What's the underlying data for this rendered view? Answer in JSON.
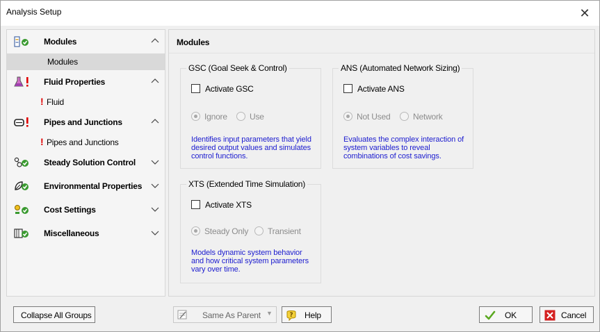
{
  "window": {
    "title": "Analysis Setup",
    "close_glyph": "✕"
  },
  "sidebar": {
    "groups": [
      {
        "label": "Modules",
        "icon": "modules-icon",
        "expanded": true,
        "items": [
          {
            "label": "Modules",
            "selected": true,
            "warning": false
          }
        ]
      },
      {
        "label": "Fluid Properties",
        "icon": "flask-warning-icon",
        "expanded": true,
        "items": [
          {
            "label": "Fluid",
            "selected": false,
            "warning": true,
            "warning_glyph": "!"
          }
        ]
      },
      {
        "label": "Pipes and Junctions",
        "icon": "pipe-warning-icon",
        "expanded": true,
        "items": [
          {
            "label": "Pipes and Junctions",
            "selected": false,
            "warning": true,
            "warning_glyph": "!"
          }
        ]
      },
      {
        "label": "Steady Solution Control",
        "icon": "solution-control-icon",
        "expanded": false,
        "items": []
      },
      {
        "label": "Environmental Properties",
        "icon": "environment-icon",
        "expanded": false,
        "items": []
      },
      {
        "label": "Cost Settings",
        "icon": "cost-icon",
        "expanded": false,
        "items": []
      },
      {
        "label": "Miscellaneous",
        "icon": "misc-icon",
        "expanded": false,
        "items": []
      }
    ]
  },
  "main": {
    "title": "Modules",
    "gsc": {
      "legend": "GSC (Goal Seek & Control)",
      "checkbox_label": "Activate GSC",
      "checked": false,
      "radio_1": "Ignore",
      "radio_2": "Use",
      "desc_1": "Identifies input parameters that yield",
      "desc_2": "desired output values and simulates",
      "desc_3": "control functions."
    },
    "ans": {
      "legend": "ANS (Automated Network Sizing)",
      "checkbox_label": "Activate ANS",
      "checked": false,
      "radio_1": "Not Used",
      "radio_2": "Network",
      "desc_1": "Evaluates the complex interaction of",
      "desc_2": "system variables to reveal",
      "desc_3": "combinations of cost savings."
    },
    "xts": {
      "legend": "XTS (Extended Time Simulation)",
      "checkbox_label": "Activate XTS",
      "checked": false,
      "radio_1": "Steady Only",
      "radio_2": "Transient",
      "desc_1": "Models dynamic system behavior",
      "desc_2": "and how critical system parameters",
      "desc_3": "vary over time."
    }
  },
  "footer": {
    "collapse_label": "Collapse All Groups",
    "same_as_parent_label": "Same As Parent",
    "help_label": "Help",
    "ok_label": "OK",
    "cancel_label": "Cancel"
  },
  "colors": {
    "warning": "#e00000",
    "ok_check": "#5aa820",
    "cancel": "#d42020",
    "desc_text": "#1c1ccf",
    "selected_item": "#d9d9d9"
  }
}
